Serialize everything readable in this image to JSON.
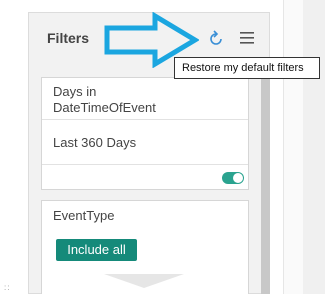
{
  "panel": {
    "title": "Filters",
    "refresh_icon": "refresh-icon",
    "menu_icon": "hamburger-menu-icon",
    "pointer_icon": "arrow-right-icon"
  },
  "tooltip": {
    "text": "Restore my default filters"
  },
  "filters": [
    {
      "label": "Days in DateTimeOfEvent",
      "value": "Last 360 Days",
      "toggle_on": true
    },
    {
      "label": "EventType",
      "button_label": "Include all"
    }
  ],
  "colors": {
    "accent": "#158a7a",
    "toggle": "#2aa38f",
    "arrow": "#1ba6e0",
    "icon": "#3a8fd6"
  }
}
